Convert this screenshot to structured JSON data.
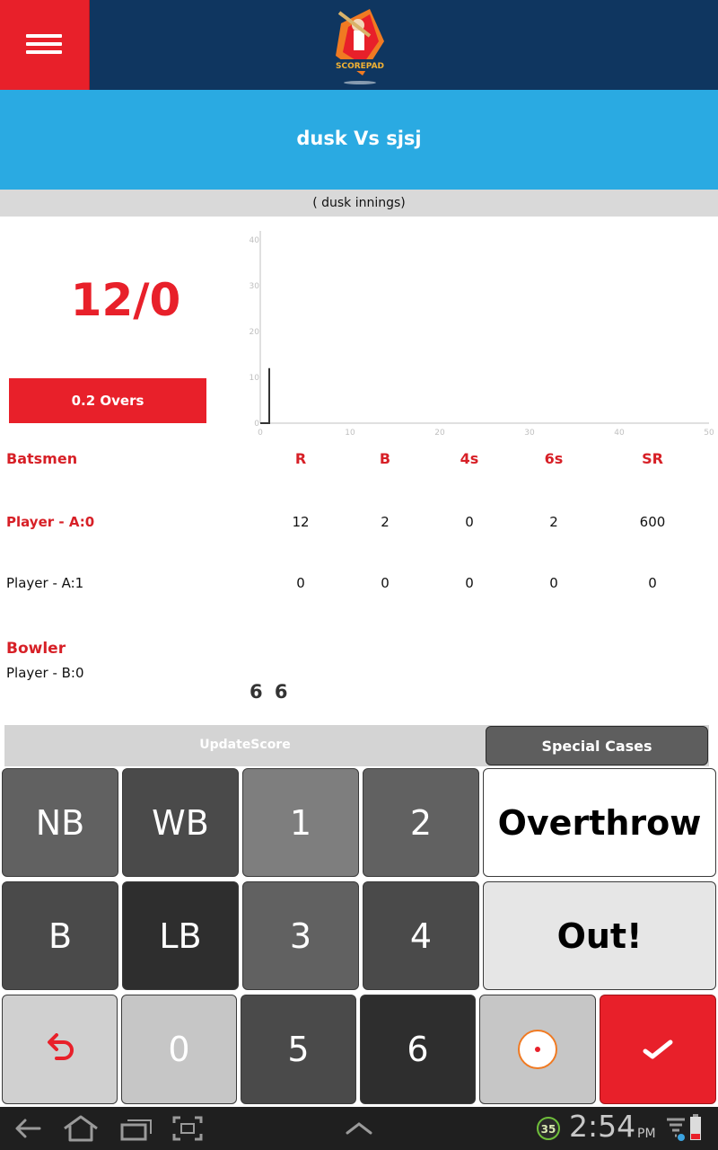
{
  "app": {
    "logo_text": "SCOREPAD"
  },
  "match": {
    "title": "dusk Vs sjsj",
    "innings": "( dusk innings)",
    "score": "12/0",
    "overs": "0.2 Overs"
  },
  "chart_data": {
    "type": "line",
    "x": [
      0,
      1,
      1
    ],
    "y": [
      0,
      0,
      12
    ],
    "xlim": [
      0,
      50
    ],
    "ylim": [
      0,
      40
    ],
    "xticks": [
      "0",
      "10",
      "20",
      "30",
      "40",
      "50"
    ],
    "yticks": [
      "0",
      "10",
      "20",
      "30",
      "40"
    ],
    "grid": false
  },
  "batsmen": {
    "header": "Batsmen",
    "columns": [
      "R",
      "B",
      "4s",
      "6s",
      "SR"
    ],
    "rows": [
      {
        "name": "Player - A:0",
        "values": [
          "12",
          "2",
          "0",
          "2",
          "600"
        ]
      },
      {
        "name": "Player - A:1",
        "values": [
          "0",
          "0",
          "0",
          "0",
          "0"
        ]
      }
    ]
  },
  "bowler": {
    "header": "Bowler",
    "name": "Player - B:0",
    "balls": "6 6"
  },
  "tabs": {
    "update": "UpdateScore",
    "special": "Special Cases"
  },
  "keypad": {
    "nb": "NB",
    "wb": "WB",
    "k1": "1",
    "k2": "2",
    "overthrow": "Overthrow",
    "b": "B",
    "lb": "LB",
    "k3": "3",
    "k4": "4",
    "out": "Out!",
    "k0": "0",
    "k5": "5",
    "k6": "6"
  },
  "status": {
    "time": "2:54",
    "ampm": "PM",
    "notification_count": "35"
  },
  "colors": {
    "brand_red": "#e8202a",
    "header_navy": "#0f3660",
    "title_blue": "#2aaae2"
  }
}
